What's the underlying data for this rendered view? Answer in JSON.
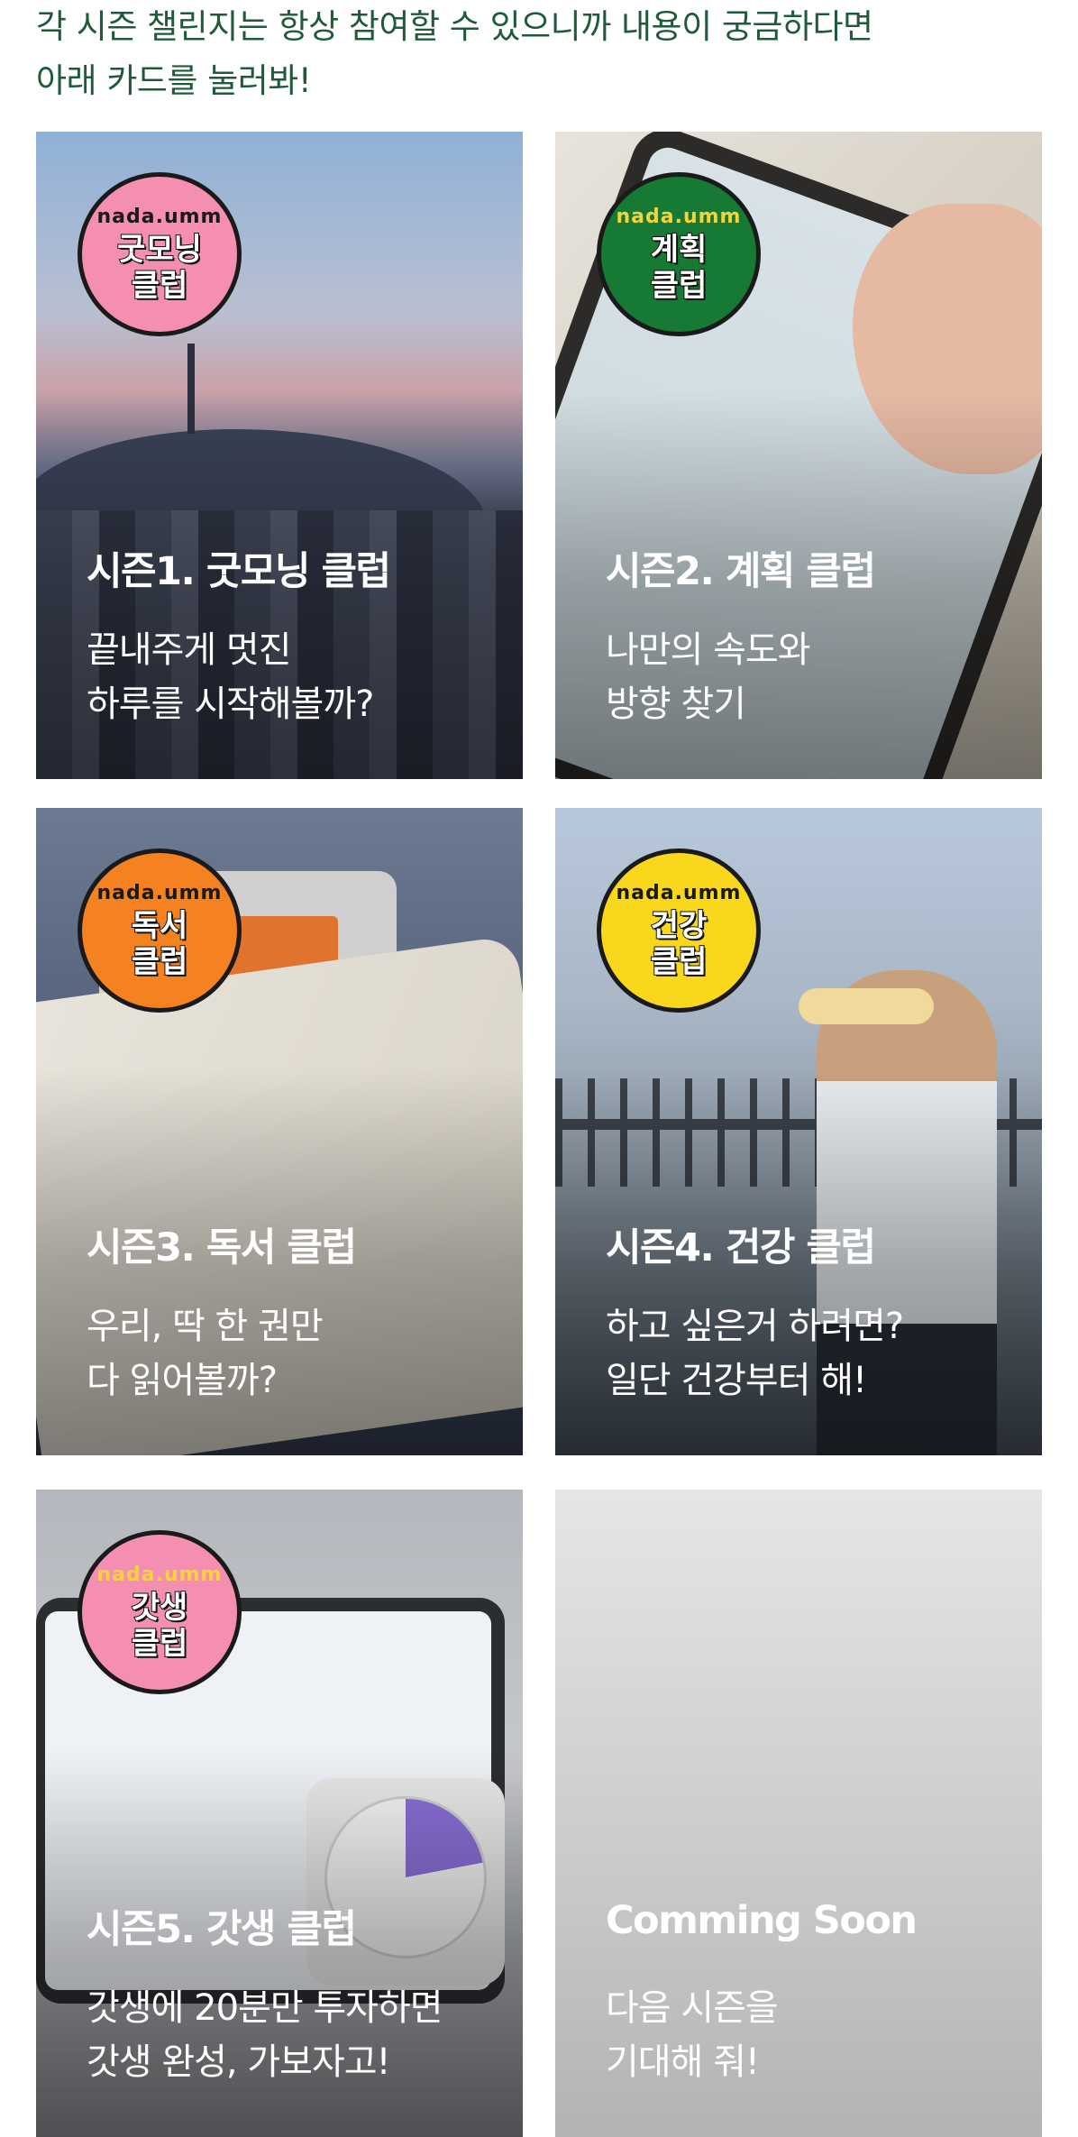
{
  "intro": {
    "line1": "각 시즌 챌린지는 항상 참여할 수 있으니까 내용이 궁금하다면",
    "line2": "아래 카드를 눌러봐!"
  },
  "colors": {
    "intro_text": "#1f5a3a"
  },
  "cards": [
    {
      "badge": {
        "brand": "nada.umm",
        "club": "굿모닝\n클럽",
        "color": "#f48fb1"
      },
      "title": "시즌1. 굿모닝 클럽",
      "desc": "끝내주게 멋진\n하루를 시작해볼까?"
    },
    {
      "badge": {
        "brand": "nada.umm",
        "club": "계획\n클럽",
        "color": "#167a34"
      },
      "title": "시즌2. 계획 클럽",
      "desc": "나만의 속도와\n방향 찾기"
    },
    {
      "badge": {
        "brand": "nada.umm",
        "club": "독서\n클럽",
        "color": "#f58220"
      },
      "title": "시즌3. 독서 클럽",
      "desc": "우리, 딱 한 권만\n다 읽어볼까?"
    },
    {
      "badge": {
        "brand": "nada.umm",
        "club": "건강\n클럽",
        "color": "#f9d71c"
      },
      "title": "시즌4. 건강 클럽",
      "desc": "하고 싶은거 하려면?\n일단 건강부터 해!"
    },
    {
      "badge": {
        "brand": "nada.umm",
        "club": "갓생\n클럽",
        "color": "#f48fb1"
      },
      "title": "시즌5. 갓생 클럽",
      "desc": "갓생에 20분만 투자하면\n갓생 완성, 가보자고!"
    },
    {
      "title": "Comming Soon",
      "desc": "다음 시즌을\n기대해 줘!"
    }
  ]
}
